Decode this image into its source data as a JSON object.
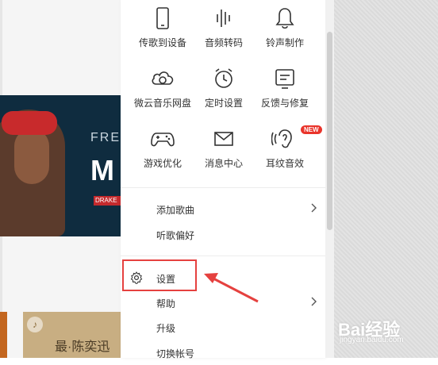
{
  "grid_row1": [
    {
      "icon": "phone-transfer-icon",
      "label": "传歌到设备"
    },
    {
      "icon": "waveform-icon",
      "label": "音频转码"
    },
    {
      "icon": "bell-icon",
      "label": "铃声制作"
    }
  ],
  "grid_row2": [
    {
      "icon": "cloud-drive-icon",
      "label": "微云音乐网盘"
    },
    {
      "icon": "alarm-clock-icon",
      "label": "定时设置"
    },
    {
      "icon": "feedback-icon",
      "label": "反馈与修复"
    }
  ],
  "grid_row3": [
    {
      "icon": "gamepad-icon",
      "label": "游戏优化"
    },
    {
      "icon": "envelope-icon",
      "label": "消息中心"
    },
    {
      "icon": "ear-sound-icon",
      "label": "耳纹音效",
      "badge": "NEW"
    }
  ],
  "list_items": [
    {
      "label": "添加歌曲",
      "has_submenu": true
    },
    {
      "label": "听歌偏好",
      "has_submenu": false
    },
    {
      "label": "设置",
      "has_submenu": false,
      "icon": "gear-icon"
    },
    {
      "label": "帮助",
      "has_submenu": true
    },
    {
      "label": "升级",
      "has_submenu": false
    },
    {
      "label": "切换帐号",
      "has_submenu": false
    }
  ],
  "banner": {
    "text_line1": "FRE",
    "text_line2": "M",
    "tag": "DRAKE"
  },
  "thumbnail": {
    "label": "最·陈奕迅"
  },
  "watermark": {
    "main": "Bai经验",
    "sub": "jingyan.baidu.com"
  },
  "colors": {
    "highlight": "#e5413f",
    "badge": "#e9342b"
  }
}
